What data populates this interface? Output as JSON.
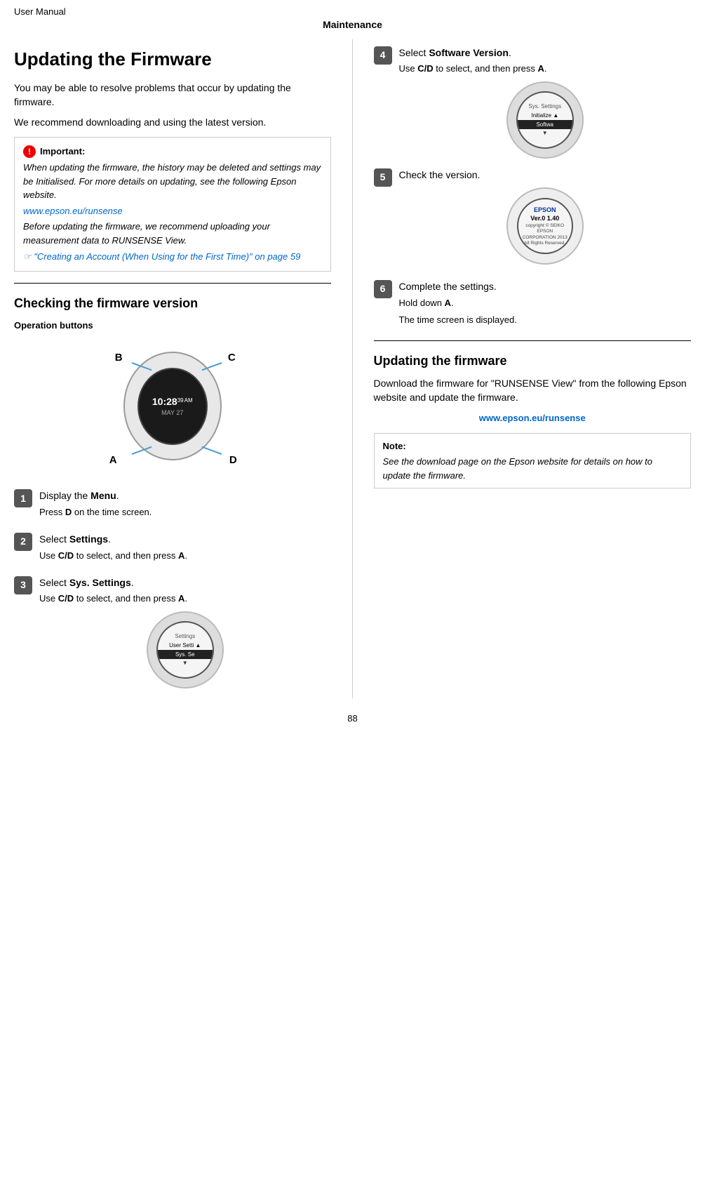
{
  "header": {
    "top_left": "User Manual",
    "center": "Maintenance"
  },
  "left_col": {
    "h1": "Updating the Firmware",
    "intro_p1": "You may be able to resolve problems that occur by updating the firmware.",
    "intro_p2": "We recommend downloading and using the latest version.",
    "important": {
      "title": "Important:",
      "body": "When updating the firmware, the history may be deleted and settings may be Initialised. For more details on updating, see the following Epson website.",
      "link": "www.epson.eu/runsense",
      "body2": "Before updating the firmware, we recommend uploading your measurement data to RUNSENSE View.",
      "see_link": "\"Creating an Account (When Using for the First Time)\" on page 59"
    },
    "h2_checking": "Checking the firmware version",
    "op_buttons": "Operation buttons",
    "steps": [
      {
        "num": "1",
        "title_plain": "Display the ",
        "title_bold": "Menu",
        "title_end": ".",
        "sub": "Press D on the time screen."
      },
      {
        "num": "2",
        "title_plain": "Select ",
        "title_bold": "Settings",
        "title_end": ".",
        "sub": "Use C/D to select, and then press A."
      },
      {
        "num": "3",
        "title_plain": "Select ",
        "title_bold": "Sys. Settings",
        "title_end": ".",
        "sub": "Use C/D to select, and then press A.",
        "has_image": true,
        "image_type": "sys_settings"
      }
    ]
  },
  "right_col": {
    "steps": [
      {
        "num": "4",
        "title_plain": "Select ",
        "title_bold": "Software Version",
        "title_end": ".",
        "sub": "Use C/D to select, and then press A.",
        "has_image": true,
        "image_type": "software_version"
      },
      {
        "num": "5",
        "title": "Check the version.",
        "has_image": true,
        "image_type": "epson_version"
      },
      {
        "num": "6",
        "title": "Complete the settings.",
        "sub1": "Hold down A.",
        "sub2": "The time screen is displayed."
      }
    ],
    "h2_updating": "Updating the firmware",
    "updating_p1": "Download the firmware for \"RUNSENSE View\" from the following Epson website and update the firmware.",
    "updating_link": "www.epson.eu/runsense",
    "note": {
      "title": "Note:",
      "body": "See the download page on the Epson website for details on how to update the firmware."
    }
  },
  "page_number": "88",
  "watch": {
    "time": "10:28",
    "seconds": "39",
    "ampm": "AM",
    "date": "MAY 27",
    "btn_b": "B",
    "btn_c": "C",
    "btn_a": "A",
    "btn_d": "D"
  },
  "sys_settings_menu": {
    "title": "Settings",
    "row1": "User Setti ▲",
    "row_selected": "Sys. Se",
    "arrow_down": "▼"
  },
  "software_version_menu": {
    "title": "Sys. Settings",
    "row1": "Initialize ▲",
    "row_selected": "Softwa",
    "arrow_down": "▼"
  },
  "epson_display": {
    "brand": "EPSON",
    "version": "Ver.0 1.40",
    "copy": "copyright © SEIKO EPSON\nCORPORATION 2013\nAll Rights Reserved."
  }
}
